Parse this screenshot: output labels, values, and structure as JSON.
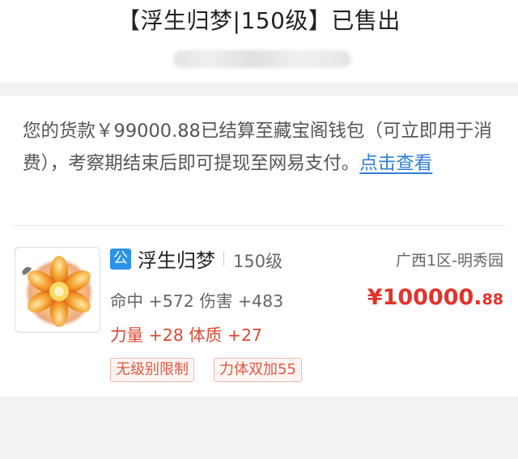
{
  "header": {
    "title": "【浮生归梦|150级】已售出"
  },
  "notice": {
    "text": "您的货款￥99000.88已结算至藏宝阁钱包（可立即用于消费），考察期结束后即可提现至网易支付。",
    "link": "点击查看"
  },
  "item": {
    "badge": "公",
    "name": "浮生归梦",
    "level": "150级",
    "server": "广西1区-明秀园",
    "stats_line1": "命中 +572 伤害 +483",
    "stats_line2": "力量 +28 体质 +27",
    "price_main": "¥100000.",
    "price_decimal": "88",
    "tags": [
      "无级别限制",
      "力体双加55"
    ]
  },
  "colors": {
    "accent_link": "#2e7fd6",
    "price_red": "#e2332b",
    "badge_blue": "#2b93e8",
    "tag_red": "#e15a44"
  },
  "icons": {
    "item_image": "golden-flower-item-icon"
  }
}
